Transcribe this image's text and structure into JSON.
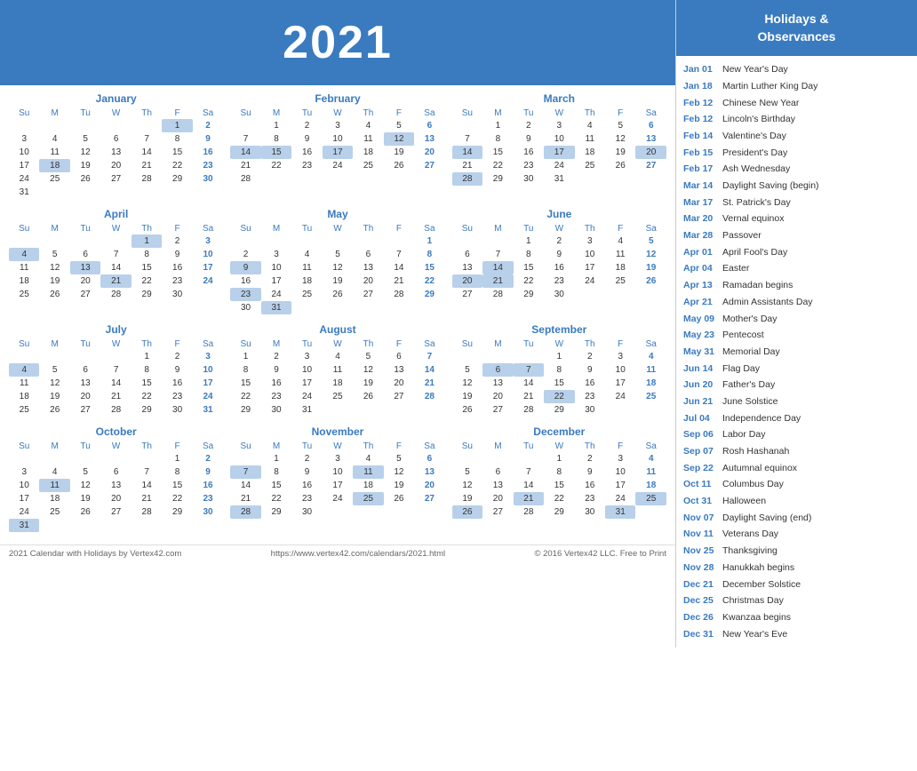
{
  "header": {
    "year": "2021"
  },
  "months": [
    {
      "name": "January",
      "days_of_week": [
        "Su",
        "M",
        "Tu",
        "W",
        "Th",
        "F",
        "Sa"
      ],
      "weeks": [
        [
          "",
          "",
          "",
          "",
          "",
          "1",
          "2"
        ],
        [
          "3",
          "4",
          "5",
          "6",
          "7",
          "8",
          "9"
        ],
        [
          "10",
          "11",
          "12",
          "13",
          "14",
          "15",
          "16"
        ],
        [
          "17",
          "18",
          "19",
          "20",
          "21",
          "22",
          "23"
        ],
        [
          "24",
          "25",
          "26",
          "27",
          "28",
          "29",
          "30"
        ],
        [
          "31",
          "",
          "",
          "",
          "",
          "",
          ""
        ]
      ],
      "highlighted": [
        "1",
        "18"
      ],
      "saturdays_blue": [
        "2",
        "9",
        "16",
        "23",
        "30"
      ]
    },
    {
      "name": "February",
      "days_of_week": [
        "Su",
        "M",
        "Tu",
        "W",
        "Th",
        "F",
        "Sa"
      ],
      "weeks": [
        [
          "",
          "1",
          "2",
          "3",
          "4",
          "5",
          "6"
        ],
        [
          "7",
          "8",
          "9",
          "10",
          "11",
          "12",
          "13"
        ],
        [
          "14",
          "15",
          "16",
          "17",
          "18",
          "19",
          "20"
        ],
        [
          "21",
          "22",
          "23",
          "24",
          "25",
          "26",
          "27"
        ],
        [
          "28",
          "",
          "",
          "",
          "",
          "",
          ""
        ]
      ],
      "highlighted": [
        "12",
        "14",
        "15",
        "17"
      ],
      "saturdays_blue": [
        "6",
        "13",
        "20",
        "27"
      ]
    },
    {
      "name": "March",
      "days_of_week": [
        "Su",
        "M",
        "Tu",
        "W",
        "Th",
        "F",
        "Sa"
      ],
      "weeks": [
        [
          "",
          "1",
          "2",
          "3",
          "4",
          "5",
          "6"
        ],
        [
          "7",
          "8",
          "9",
          "10",
          "11",
          "12",
          "13"
        ],
        [
          "14",
          "15",
          "16",
          "17",
          "18",
          "19",
          "20"
        ],
        [
          "21",
          "22",
          "23",
          "24",
          "25",
          "26",
          "27"
        ],
        [
          "28",
          "29",
          "30",
          "31",
          "",
          "",
          ""
        ]
      ],
      "highlighted": [
        "14",
        "17",
        "20",
        "28"
      ],
      "saturdays_blue": [
        "6",
        "13",
        "20",
        "27"
      ]
    },
    {
      "name": "April",
      "days_of_week": [
        "Su",
        "M",
        "Tu",
        "W",
        "Th",
        "F",
        "Sa"
      ],
      "weeks": [
        [
          "",
          "",
          "",
          "",
          "1",
          "2",
          "3"
        ],
        [
          "4",
          "5",
          "6",
          "7",
          "8",
          "9",
          "10"
        ],
        [
          "11",
          "12",
          "13",
          "14",
          "15",
          "16",
          "17"
        ],
        [
          "18",
          "19",
          "20",
          "21",
          "22",
          "23",
          "24"
        ],
        [
          "25",
          "26",
          "27",
          "28",
          "29",
          "30",
          ""
        ]
      ],
      "highlighted": [
        "1",
        "4",
        "13",
        "21"
      ],
      "saturdays_blue": [
        "3",
        "10",
        "17",
        "24"
      ]
    },
    {
      "name": "May",
      "days_of_week": [
        "Su",
        "M",
        "Tu",
        "W",
        "Th",
        "F",
        "Sa"
      ],
      "weeks": [
        [
          "",
          "",
          "",
          "",
          "",
          "",
          "1"
        ],
        [
          "2",
          "3",
          "4",
          "5",
          "6",
          "7",
          "8"
        ],
        [
          "9",
          "10",
          "11",
          "12",
          "13",
          "14",
          "15"
        ],
        [
          "16",
          "17",
          "18",
          "19",
          "20",
          "21",
          "22"
        ],
        [
          "23",
          "24",
          "25",
          "26",
          "27",
          "28",
          "29"
        ],
        [
          "30",
          "31",
          "",
          "",
          "",
          "",
          ""
        ]
      ],
      "highlighted": [
        "9",
        "23",
        "31"
      ],
      "saturdays_blue": [
        "1",
        "8",
        "15",
        "22",
        "29"
      ]
    },
    {
      "name": "June",
      "days_of_week": [
        "Su",
        "M",
        "Tu",
        "W",
        "Th",
        "F",
        "Sa"
      ],
      "weeks": [
        [
          "",
          "",
          "1",
          "2",
          "3",
          "4",
          "5"
        ],
        [
          "6",
          "7",
          "8",
          "9",
          "10",
          "11",
          "12"
        ],
        [
          "13",
          "14",
          "15",
          "16",
          "17",
          "18",
          "19"
        ],
        [
          "20",
          "21",
          "22",
          "23",
          "24",
          "25",
          "26"
        ],
        [
          "27",
          "28",
          "29",
          "30",
          "",
          "",
          ""
        ]
      ],
      "highlighted": [
        "14",
        "20",
        "21"
      ],
      "saturdays_blue": [
        "5",
        "12",
        "19",
        "26"
      ]
    },
    {
      "name": "July",
      "days_of_week": [
        "Su",
        "M",
        "Tu",
        "W",
        "Th",
        "F",
        "Sa"
      ],
      "weeks": [
        [
          "",
          "",
          "",
          "",
          "1",
          "2",
          "3"
        ],
        [
          "4",
          "5",
          "6",
          "7",
          "8",
          "9",
          "10"
        ],
        [
          "11",
          "12",
          "13",
          "14",
          "15",
          "16",
          "17"
        ],
        [
          "18",
          "19",
          "20",
          "21",
          "22",
          "23",
          "24"
        ],
        [
          "25",
          "26",
          "27",
          "28",
          "29",
          "30",
          "31"
        ]
      ],
      "highlighted": [
        "4"
      ],
      "saturdays_blue": [
        "3",
        "10",
        "17",
        "24",
        "31"
      ]
    },
    {
      "name": "August",
      "days_of_week": [
        "Su",
        "M",
        "Tu",
        "W",
        "Th",
        "F",
        "Sa"
      ],
      "weeks": [
        [
          "1",
          "2",
          "3",
          "4",
          "5",
          "6",
          "7"
        ],
        [
          "8",
          "9",
          "10",
          "11",
          "12",
          "13",
          "14"
        ],
        [
          "15",
          "16",
          "17",
          "18",
          "19",
          "20",
          "21"
        ],
        [
          "22",
          "23",
          "24",
          "25",
          "26",
          "27",
          "28"
        ],
        [
          "29",
          "30",
          "31",
          "",
          "",
          "",
          ""
        ]
      ],
      "highlighted": [],
      "saturdays_blue": [
        "7",
        "14",
        "21",
        "28"
      ]
    },
    {
      "name": "September",
      "days_of_week": [
        "Su",
        "M",
        "Tu",
        "W",
        "Th",
        "F",
        "Sa"
      ],
      "weeks": [
        [
          "",
          "",
          "",
          "1",
          "2",
          "3",
          "4"
        ],
        [
          "5",
          "6",
          "7",
          "8",
          "9",
          "10",
          "11"
        ],
        [
          "12",
          "13",
          "14",
          "15",
          "16",
          "17",
          "18"
        ],
        [
          "19",
          "20",
          "21",
          "22",
          "23",
          "24",
          "25"
        ],
        [
          "26",
          "27",
          "28",
          "29",
          "30",
          "",
          ""
        ]
      ],
      "highlighted": [
        "6",
        "7",
        "22"
      ],
      "saturdays_blue": [
        "4",
        "11",
        "18",
        "25"
      ]
    },
    {
      "name": "October",
      "days_of_week": [
        "Su",
        "M",
        "Tu",
        "W",
        "Th",
        "F",
        "Sa"
      ],
      "weeks": [
        [
          "",
          "",
          "",
          "",
          "",
          "1",
          "2"
        ],
        [
          "3",
          "4",
          "5",
          "6",
          "7",
          "8",
          "9"
        ],
        [
          "10",
          "11",
          "12",
          "13",
          "14",
          "15",
          "16"
        ],
        [
          "17",
          "18",
          "19",
          "20",
          "21",
          "22",
          "23"
        ],
        [
          "24",
          "25",
          "26",
          "27",
          "28",
          "29",
          "30"
        ],
        [
          "31",
          "",
          "",
          "",
          "",
          "",
          ""
        ]
      ],
      "highlighted": [
        "11",
        "31"
      ],
      "saturdays_blue": [
        "2",
        "9",
        "16",
        "23",
        "30"
      ]
    },
    {
      "name": "November",
      "days_of_week": [
        "Su",
        "M",
        "Tu",
        "W",
        "Th",
        "F",
        "Sa"
      ],
      "weeks": [
        [
          "",
          "1",
          "2",
          "3",
          "4",
          "5",
          "6"
        ],
        [
          "7",
          "8",
          "9",
          "10",
          "11",
          "12",
          "13"
        ],
        [
          "14",
          "15",
          "16",
          "17",
          "18",
          "19",
          "20"
        ],
        [
          "21",
          "22",
          "23",
          "24",
          "25",
          "26",
          "27"
        ],
        [
          "28",
          "29",
          "30",
          "",
          "",
          "",
          ""
        ]
      ],
      "highlighted": [
        "7",
        "11",
        "25",
        "28"
      ],
      "saturdays_blue": [
        "6",
        "13",
        "20",
        "27"
      ]
    },
    {
      "name": "December",
      "days_of_week": [
        "Su",
        "M",
        "Tu",
        "W",
        "Th",
        "F",
        "Sa"
      ],
      "weeks": [
        [
          "",
          "",
          "",
          "1",
          "2",
          "3",
          "4"
        ],
        [
          "5",
          "6",
          "7",
          "8",
          "9",
          "10",
          "11"
        ],
        [
          "12",
          "13",
          "14",
          "15",
          "16",
          "17",
          "18"
        ],
        [
          "19",
          "20",
          "21",
          "22",
          "23",
          "24",
          "25"
        ],
        [
          "26",
          "27",
          "28",
          "29",
          "30",
          "31",
          ""
        ]
      ],
      "highlighted": [
        "21",
        "25",
        "26",
        "31"
      ],
      "saturdays_blue": [
        "4",
        "11",
        "18",
        "25"
      ]
    }
  ],
  "sidebar": {
    "title": "Holidays &\nObservances",
    "items": [
      {
        "date": "Jan 01",
        "name": "New Year's Day"
      },
      {
        "date": "Jan 18",
        "name": "Martin Luther King Day"
      },
      {
        "date": "Feb 12",
        "name": "Chinese New Year"
      },
      {
        "date": "Feb 12",
        "name": "Lincoln's Birthday"
      },
      {
        "date": "Feb 14",
        "name": "Valentine's Day"
      },
      {
        "date": "Feb 15",
        "name": "President's Day"
      },
      {
        "date": "Feb 17",
        "name": "Ash Wednesday"
      },
      {
        "date": "Mar 14",
        "name": "Daylight Saving (begin)"
      },
      {
        "date": "Mar 17",
        "name": "St. Patrick's Day"
      },
      {
        "date": "Mar 20",
        "name": "Vernal equinox"
      },
      {
        "date": "Mar 28",
        "name": "Passover"
      },
      {
        "date": "Apr 01",
        "name": "April Fool's Day"
      },
      {
        "date": "Apr 04",
        "name": "Easter"
      },
      {
        "date": "Apr 13",
        "name": "Ramadan begins"
      },
      {
        "date": "Apr 21",
        "name": "Admin Assistants Day"
      },
      {
        "date": "May 09",
        "name": "Mother's Day"
      },
      {
        "date": "May 23",
        "name": "Pentecost"
      },
      {
        "date": "May 31",
        "name": "Memorial Day"
      },
      {
        "date": "Jun 14",
        "name": "Flag Day"
      },
      {
        "date": "Jun 20",
        "name": "Father's Day"
      },
      {
        "date": "Jun 21",
        "name": "June Solstice"
      },
      {
        "date": "Jul 04",
        "name": "Independence Day"
      },
      {
        "date": "Sep 06",
        "name": "Labor Day"
      },
      {
        "date": "Sep 07",
        "name": "Rosh Hashanah"
      },
      {
        "date": "Sep 22",
        "name": "Autumnal equinox"
      },
      {
        "date": "Oct 11",
        "name": "Columbus Day"
      },
      {
        "date": "Oct 31",
        "name": "Halloween"
      },
      {
        "date": "Nov 07",
        "name": "Daylight Saving (end)"
      },
      {
        "date": "Nov 11",
        "name": "Veterans Day"
      },
      {
        "date": "Nov 25",
        "name": "Thanksgiving"
      },
      {
        "date": "Nov 28",
        "name": "Hanukkah begins"
      },
      {
        "date": "Dec 21",
        "name": "December Solstice"
      },
      {
        "date": "Dec 25",
        "name": "Christmas Day"
      },
      {
        "date": "Dec 26",
        "name": "Kwanzaa begins"
      },
      {
        "date": "Dec 31",
        "name": "New Year's Eve"
      }
    ]
  },
  "footer": {
    "left": "2021 Calendar with Holidays by Vertex42.com",
    "center": "https://www.vertex42.com/calendars/2021.html",
    "right": "© 2016 Vertex42 LLC. Free to Print"
  }
}
